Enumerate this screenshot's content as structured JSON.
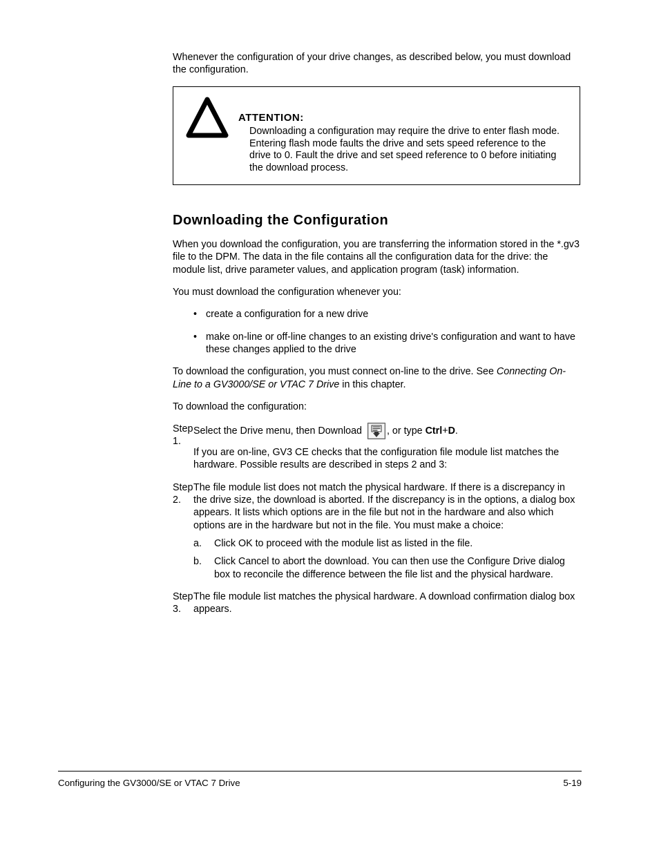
{
  "content": {
    "intro": "Whenever the configuration of your drive changes, as described below, you must download the configuration.",
    "attention": {
      "title": "ATTENTION:",
      "body": "Downloading a configuration may require the drive to enter flash mode. Entering flash mode faults the drive and sets speed reference to the drive to 0. Fault the drive and set speed reference to 0 before initiating the download process."
    },
    "section_heading": "Downloading the Configuration",
    "para1": "When you download the configuration, you are transferring the information stored in the *.gv3 file to the DPM. The data in the file contains all the configuration data for the drive: the module list, drive parameter values, and application program (task) information.",
    "para2": "You must download the configuration whenever you:",
    "bullets": [
      "create a configuration for a new drive",
      "make on-line or off-line changes to an existing drive's configuration and want to have these changes applied to the drive"
    ],
    "para3_prefix": "To download the configuration, you must connect on-line to the drive. See ",
    "para3_link": "Connecting On-Line to a GV3000/SE or VTAC 7 Drive",
    "para3_suffix": " in this chapter.",
    "para4": "To download the configuration:",
    "step1_num": "Step 1.",
    "step1_text_before": "Select the Drive menu, then Download ",
    "step1_text_after": ", or type ",
    "step1_key1": "Ctrl",
    "step1_plus": "+",
    "step1_key2": "D",
    "step1_period": ".",
    "step1_cont": "If you are on-line, GV3 CE checks that the configuration file module list matches the hardware. Possible results are described in steps 2 and 3:",
    "step2_num": "Step 2.",
    "step2_text": "The file module list does not match the physical hardware. If there is a discrepancy in the drive size, the download is aborted. If the discrepancy is in the options, a dialog box appears. It lists which options are in the file but not in the hardware and also which options are in the hardware but not in the file. You must make a choice:",
    "sub_a": "a.",
    "sub_a_text": "Click OK to proceed with the module list as listed in the file.",
    "sub_b": "b.",
    "sub_b_text": "Click Cancel to abort the download. You can then use the Configure Drive dialog box to reconcile the difference between the file list and the physical hardware.",
    "step3_num": "Step 3.",
    "step3_text": "The file module list matches the physical hardware. A download confirmation dialog box appears."
  },
  "footer": {
    "text": "Configuring the GV3000/SE or VTAC 7 Drive",
    "page": "5-19"
  }
}
